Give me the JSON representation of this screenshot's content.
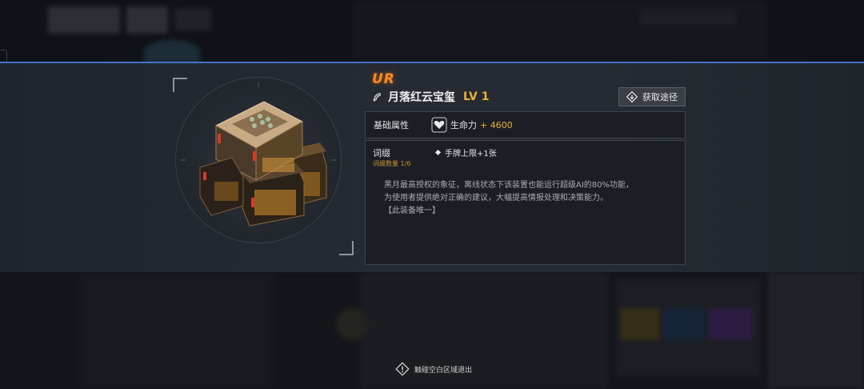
{
  "item": {
    "rarity": "UR",
    "name": "月落红云宝玺",
    "level": "LV 1"
  },
  "obtain_button": {
    "label": "获取途径"
  },
  "base_attributes": {
    "label": "基础属性",
    "stat_name": "生命力",
    "stat_value": "+ 4600"
  },
  "affix": {
    "label": "词缀",
    "count": "词缀数量 1/6",
    "entry": "手牌上限+1张"
  },
  "description": {
    "line1": "黑月最高授权的象征，离线状态下该装置也能运行超级AI的80%功能，",
    "line2": "为使用者提供绝对正确的建议，大幅提高情报处理和决策能力。",
    "line3": "【此装备唯一】"
  },
  "exit_hint": "触碰空白区域退出",
  "colors": {
    "rarity": "#ff8a1e",
    "level": "#f0b232",
    "accent_line": "#3f73c7"
  }
}
